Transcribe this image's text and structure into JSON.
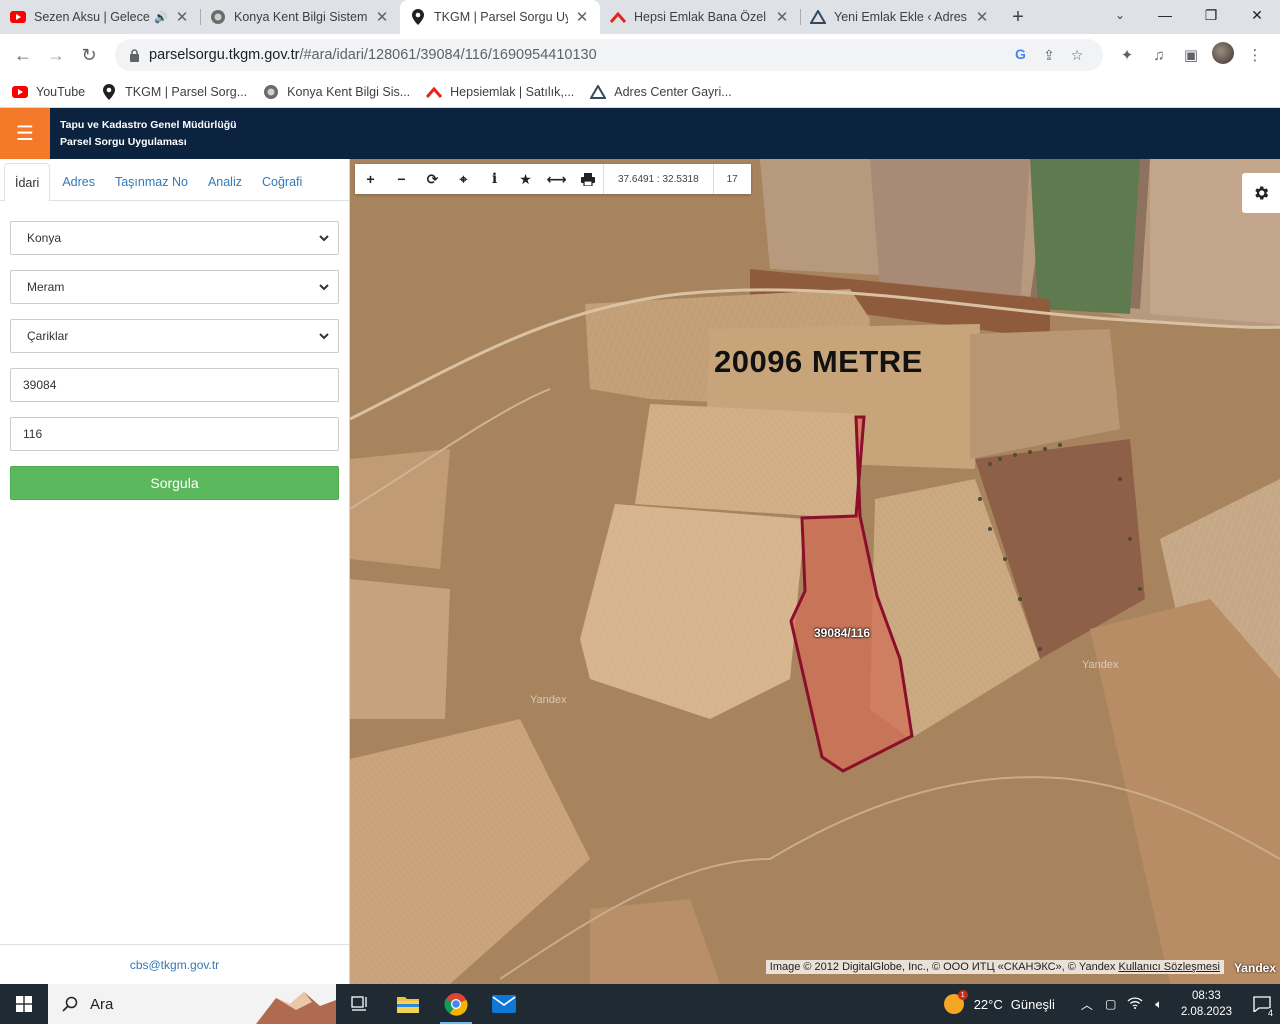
{
  "browser": {
    "tabs": [
      {
        "title": "Sezen Aksu | Gelecek",
        "favicon": "youtube-icon",
        "audio": true
      },
      {
        "title": "Konya Kent Bilgi Sistemi",
        "favicon": "city-emblem-icon"
      },
      {
        "title": "TKGM | Parsel Sorgu Uyg",
        "favicon": "map-pin-icon",
        "active": true
      },
      {
        "title": "Hepsi Emlak Bana Özel",
        "favicon": "hepsiemlak-icon"
      },
      {
        "title": "Yeni Emlak Ekle ‹ Adres C",
        "favicon": "adres-center-icon"
      }
    ],
    "url_host": "parselsorgu.tkgm.gov.tr",
    "url_path": "/#ara/idari/128061/39084/116/1690954410130",
    "bookmarks": [
      {
        "label": "YouTube"
      },
      {
        "label": "TKGM | Parsel Sorg..."
      },
      {
        "label": "Konya Kent Bilgi Sis..."
      },
      {
        "label": "Hepsiemlak | Satılık,..."
      },
      {
        "label": "Adres Center Gayri..."
      }
    ]
  },
  "app": {
    "brand_line1": "Tapu ve Kadastro Genel Müdürlüğü",
    "brand_line2": "Parsel Sorgu Uygulaması",
    "accent": "#f47a2a",
    "header_bg": "#0c2340"
  },
  "panel": {
    "tabs": [
      "İdari",
      "Adres",
      "Taşınmaz No",
      "Analiz",
      "Coğrafi"
    ],
    "il": "Konya",
    "ilce": "Meram",
    "mahalle": "Çariklar",
    "ada": "39084",
    "parsel": "116",
    "submit_label": "Sorgula",
    "footer_email": "cbs@tkgm.gov.tr"
  },
  "map": {
    "coordinates": "37.6491 : 32.5318",
    "zoom": "17",
    "distance_label": "20096 METRE",
    "parcel_label": "39084/116",
    "watermark": "Yandex",
    "attribution": "Image © 2012 DigitalGlobe, Inc., © ООО ИТЦ «СКАНЭКС», © Yandex",
    "terms_link": "Kullanıcı Sözleşmesi",
    "provider": "Yandex",
    "parcel_color": "#8b0f2a"
  },
  "taskbar": {
    "search_placeholder": "Ara",
    "weather_temp": "22°C",
    "weather_text": "Güneşli",
    "weather_badge": "1",
    "time": "08:33",
    "date": "2.08.2023",
    "notif_count": "4"
  }
}
